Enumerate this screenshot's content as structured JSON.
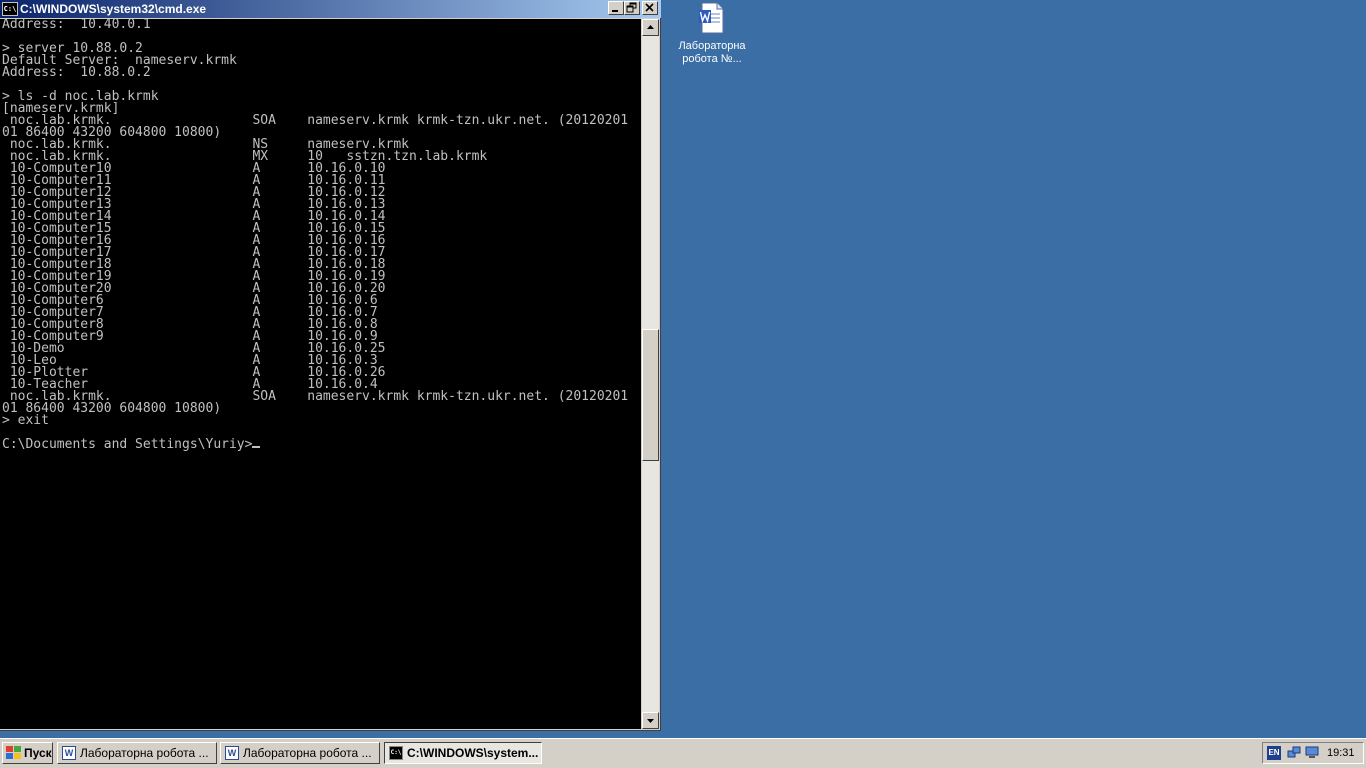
{
  "window": {
    "title": "C:\\WINDOWS\\system32\\cmd.exe",
    "console_lines": [
      "Address:  10.40.0.1",
      "",
      "> server 10.88.0.2",
      "Default Server:  nameserv.krmk",
      "Address:  10.88.0.2",
      "",
      "> ls -d noc.lab.krmk",
      "[nameserv.krmk]",
      " noc.lab.krmk.                  SOA    nameserv.krmk krmk-tzn.ukr.net. (20120201",
      "01 86400 43200 604800 10800)",
      " noc.lab.krmk.                  NS     nameserv.krmk",
      " noc.lab.krmk.                  MX     10   sstzn.tzn.lab.krmk",
      " 10-Computer10                  A      10.16.0.10",
      " 10-Computer11                  A      10.16.0.11",
      " 10-Computer12                  A      10.16.0.12",
      " 10-Computer13                  A      10.16.0.13",
      " 10-Computer14                  A      10.16.0.14",
      " 10-Computer15                  A      10.16.0.15",
      " 10-Computer16                  A      10.16.0.16",
      " 10-Computer17                  A      10.16.0.17",
      " 10-Computer18                  A      10.16.0.18",
      " 10-Computer19                  A      10.16.0.19",
      " 10-Computer20                  A      10.16.0.20",
      " 10-Computer6                   A      10.16.0.6",
      " 10-Computer7                   A      10.16.0.7",
      " 10-Computer8                   A      10.16.0.8",
      " 10-Computer9                   A      10.16.0.9",
      " 10-Demo                        A      10.16.0.25",
      " 10-Leo                         A      10.16.0.3",
      " 10-Plotter                     A      10.16.0.26",
      " 10-Teacher                     A      10.16.0.4",
      " noc.lab.krmk.                  SOA    nameserv.krmk krmk-tzn.ukr.net. (20120201",
      "01 86400 43200 604800 10800)",
      "> exit",
      ""
    ],
    "prompt": "C:\\Documents and Settings\\Yuriy>",
    "app_icon_text": "C:\\"
  },
  "desktop": {
    "icon_label": "Лабораторна робота №..."
  },
  "taskbar": {
    "start_label": "Пуск",
    "tasks": [
      {
        "label": "Лабораторна робота ..."
      },
      {
        "label": "Лабораторна робота ..."
      },
      {
        "label": "C:\\WINDOWS\\system..."
      }
    ],
    "lang": "EN",
    "clock": "19:31"
  }
}
